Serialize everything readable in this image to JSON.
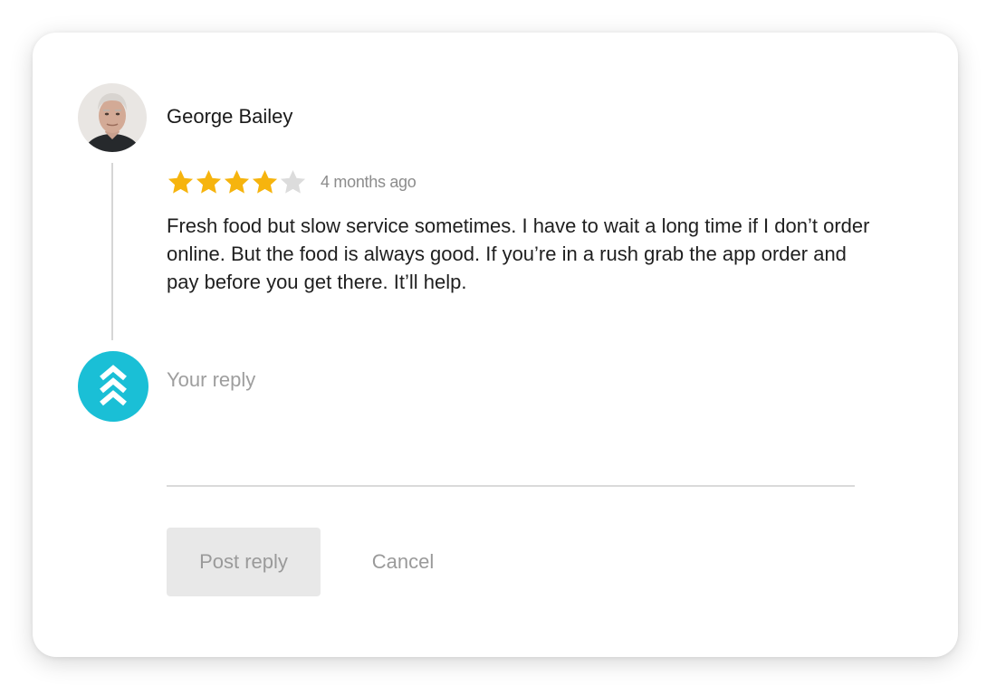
{
  "review": {
    "reviewer_name": "George Bailey",
    "rating": 4,
    "rating_max": 5,
    "timestamp": "4 months ago",
    "text": "Fresh food but slow service sometimes. I have to wait a long time if I don’t order online. But the food is always good. If you’re in a rush grab the app order and pay before you get there. It’ll help."
  },
  "reply": {
    "value": "",
    "placeholder": "Your reply",
    "post_label": "Post reply",
    "cancel_label": "Cancel"
  },
  "icons": {
    "reviewer_avatar": "person-photo-avatar",
    "business_avatar": "chevrons-up-icon",
    "star": "star-icon"
  },
  "colors": {
    "star_filled": "#f6b40e",
    "star_empty": "#dcdcdc",
    "brand": "#1abfd6",
    "button_bg": "#e8e8e8",
    "muted_text": "#9a9a9a"
  }
}
